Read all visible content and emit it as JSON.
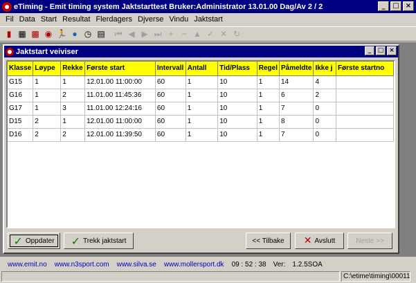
{
  "app": {
    "title": "eTiming - Emit timing system  Jaktstarttest   Bruker:Administrator   13.01.00   Dag/Av 2 / 2"
  },
  "menu": [
    "Fil",
    "Data",
    "Start",
    "Resultat",
    "Flerdagers",
    "Djverse",
    "Vindu",
    "Jaktstart"
  ],
  "toolbar": {
    "icons": [
      "card-icon",
      "calendar-icon",
      "calendar-grid-icon",
      "target-icon",
      "runner-icon",
      "globe-icon",
      "stopwatch-icon",
      "document-icon",
      "first-icon",
      "prev-icon",
      "play-icon",
      "next-icon",
      "add-icon",
      "remove-icon",
      "up-icon",
      "confirm-icon",
      "cancel-icon",
      "refresh-icon"
    ]
  },
  "window": {
    "title": "Jaktstart veiviser"
  },
  "table": {
    "columns": [
      "Klasse",
      "Løype",
      "Rekke",
      "Første start",
      "Intervall",
      "Antall",
      "Tid/Plass",
      "Regel",
      "Påmeldte",
      "Ikke j",
      "Første startno"
    ],
    "rows": [
      [
        "G15",
        "1",
        "1",
        "12.01.00 11:00:00",
        "60",
        "1",
        "10",
        "1",
        "14",
        "4",
        ""
      ],
      [
        "G16",
        "1",
        "2",
        "11.01.00 11:45:36",
        "60",
        "1",
        "10",
        "1",
        "6",
        "2",
        ""
      ],
      [
        "G17",
        "1",
        "3",
        "11.01.00 12:24:16",
        "60",
        "1",
        "10",
        "1",
        "7",
        "0",
        ""
      ],
      [
        "D15",
        "2",
        "1",
        "12.01.00 11:00:00",
        "60",
        "1",
        "10",
        "1",
        "8",
        "0",
        ""
      ],
      [
        "D16",
        "2",
        "2",
        "12.01.00 11:39:50",
        "60",
        "1",
        "10",
        "1",
        "7",
        "0",
        ""
      ]
    ]
  },
  "buttons": {
    "update": "Oppdater",
    "draw": "Trekk jaktstart",
    "back": "<< Tilbake",
    "quit": "Avslutt",
    "next": "Neste >>"
  },
  "footer": {
    "links": [
      "www.emit.no",
      "www.n3sport.com",
      "www.silva.se",
      "www.mollersport.dk"
    ],
    "time": "09 : 52 : 38",
    "version_label": "Ver:",
    "version": "1.2.5SOA"
  },
  "status": {
    "path": "C:\\etime\\timing\\00011"
  }
}
